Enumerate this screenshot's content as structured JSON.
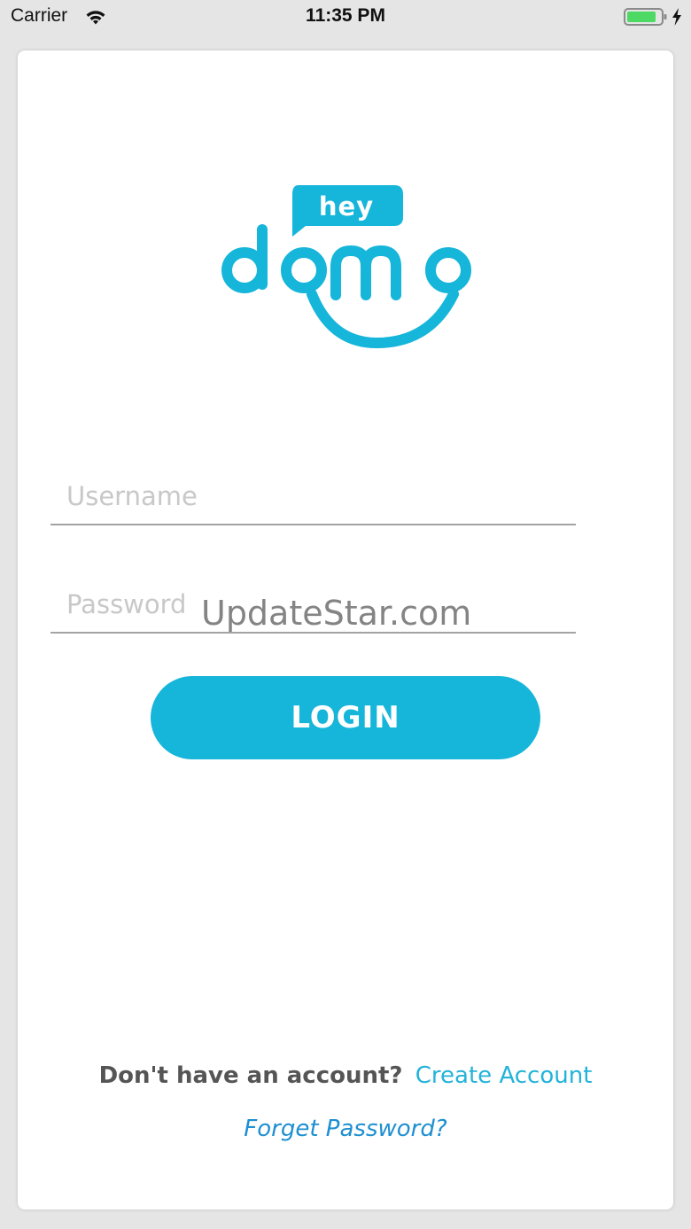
{
  "status_bar": {
    "carrier": "Carrier",
    "time": "11:35 PM",
    "wifi_icon": "wifi-icon",
    "battery_icon": "battery-icon",
    "charging_icon": "lightning-bolt-icon"
  },
  "logo": {
    "word_small": "hey",
    "word_main": "domo",
    "color": "#16b5da"
  },
  "form": {
    "username_placeholder": "Username",
    "username_value": "",
    "password_placeholder": "Password",
    "password_value": "",
    "login_label": "LOGIN"
  },
  "watermark": "UpdateStar.com",
  "footer": {
    "signup_prompt": "Don't have an account?",
    "create_account_label": "Create Account",
    "forgot_password_label": "Forget Password?"
  },
  "colors": {
    "accent": "#16b5da",
    "link": "#23b3d9",
    "link_italic": "#1e8fd0",
    "background": "#e5e5e5",
    "card": "#ffffff",
    "battery": "#4cd964"
  }
}
